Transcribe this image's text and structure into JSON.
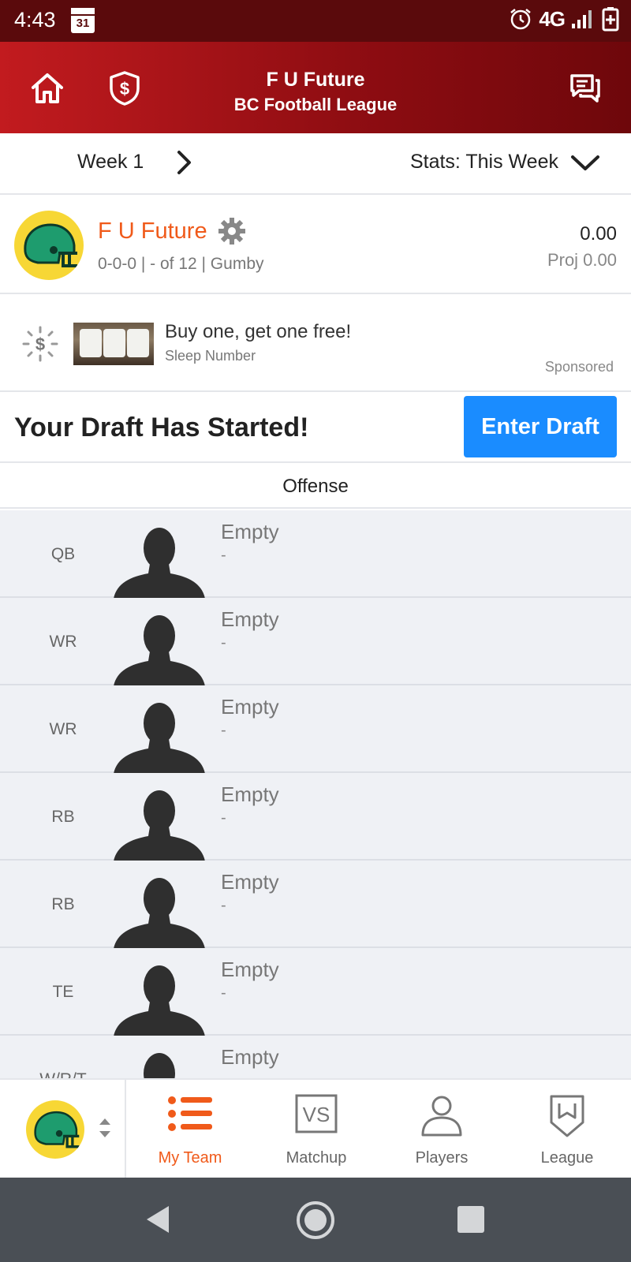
{
  "status_bar": {
    "time": "4:43",
    "calendar_day": "31",
    "network": "4G"
  },
  "header": {
    "title": "F U Future",
    "subtitle": "BC Football League"
  },
  "week_bar": {
    "week_label": "Week 1",
    "stats_label": "Stats: This Week"
  },
  "team": {
    "name": "F U Future",
    "meta": "0-0-0 | - of 12 | Gumby",
    "score": "0.00",
    "projection": "Proj 0.00"
  },
  "ad": {
    "title": "Buy one, get one free!",
    "advertiser": "Sleep Number",
    "sponsored_label": "Sponsored"
  },
  "draft": {
    "title": "Your Draft Has Started!",
    "button_label": "Enter Draft"
  },
  "section": {
    "title": "Offense"
  },
  "roster": [
    {
      "position": "QB",
      "name": "Empty",
      "detail": "-"
    },
    {
      "position": "WR",
      "name": "Empty",
      "detail": "-"
    },
    {
      "position": "WR",
      "name": "Empty",
      "detail": "-"
    },
    {
      "position": "RB",
      "name": "Empty",
      "detail": "-"
    },
    {
      "position": "RB",
      "name": "Empty",
      "detail": "-"
    },
    {
      "position": "TE",
      "name": "Empty",
      "detail": "-"
    },
    {
      "position": "W/R/T",
      "name": "Empty",
      "detail": "-"
    }
  ],
  "bottom_nav": {
    "tabs": [
      {
        "label": "My Team",
        "icon": "list-icon",
        "active": true
      },
      {
        "label": "Matchup",
        "icon": "vs-icon",
        "active": false
      },
      {
        "label": "Players",
        "icon": "person-icon",
        "active": false
      },
      {
        "label": "League",
        "icon": "shield-icon",
        "active": false
      }
    ]
  },
  "colors": {
    "header_red": "#c21b1f",
    "accent_orange": "#f05a1a",
    "button_blue": "#1a8cff",
    "avatar_yellow": "#f7d735",
    "helmet_green": "#1e9c6e"
  }
}
